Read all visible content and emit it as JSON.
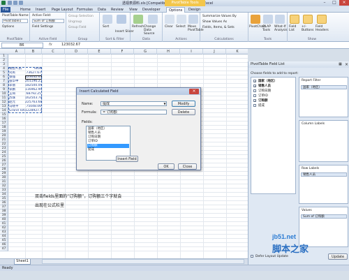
{
  "window": {
    "title": "透视表源料.xls [Compatibility Mode] - Microsoft Excel",
    "context_tab": "PivotTable Tools"
  },
  "tabs": [
    "File",
    "Home",
    "Insert",
    "Page Layout",
    "Formulas",
    "Data",
    "Review",
    "View",
    "Developer",
    "Options",
    "Design"
  ],
  "ribbon": {
    "pivottable": {
      "name_label": "PivotTable Name:",
      "name_value": "PivotTable1",
      "options": "Options",
      "group": "PivotTable"
    },
    "active_field": {
      "label": "Active Field:",
      "value": "Sum of 订购额",
      "settings": "Field Settings",
      "group": "Active Field"
    },
    "group_grp": {
      "items": [
        "Group Selection",
        "Ungroup",
        "Group Field"
      ],
      "group": "Group"
    },
    "sort": {
      "sort": "Sort",
      "group": "Sort & Filter",
      "insert_slicer": "Insert Slicer"
    },
    "data": {
      "refresh": "Refresh",
      "change_source": "Change Data Source",
      "group": "Data"
    },
    "actions": {
      "clear": "Clear",
      "select": "Select",
      "move": "Move PivotTable",
      "group": "Actions"
    },
    "calculations": {
      "items": [
        "Summarize Values By",
        "Show Values As",
        "Fields, Items, & Sets"
      ],
      "group": "Calculations"
    },
    "tools": {
      "items": [
        "PivotChart",
        "OLAP Tools",
        "What-If Analysis"
      ],
      "group": "Tools"
    },
    "show": {
      "items": [
        "Field List",
        "+/- Buttons",
        "Field Headers"
      ],
      "group": "Show"
    }
  },
  "formula_bar": {
    "name_box": "B6",
    "fx": "fx",
    "value": "123032.67"
  },
  "sheet": {
    "columns": [
      "A",
      "B",
      "C",
      "D",
      "E",
      "F",
      "G",
      "H",
      "I",
      "J",
      "K"
    ],
    "rows": [
      {
        "n": "1",
        "a": "",
        "b": ""
      },
      {
        "n": "2",
        "a": "",
        "b": ""
      },
      {
        "n": "3",
        "a": "",
        "b": ""
      },
      {
        "n": "4",
        "a": "销售人员",
        "b": "Total"
      },
      {
        "n": "5",
        "a": "刘英",
        "b": "73627.67"
      },
      {
        "n": "6",
        "a": "张强",
        "b": "123032.67"
      },
      {
        "n": "7",
        "a": "张华中",
        "b": "201196.27"
      },
      {
        "n": "8",
        "a": "李丽",
        "b": "182500.09"
      },
      {
        "n": "9",
        "a": "李鹏",
        "b": "116962.99"
      },
      {
        "n": "10",
        "a": "王琦",
        "b": "68792.25"
      },
      {
        "n": "11",
        "a": "苏珠",
        "b": "162503.78"
      },
      {
        "n": "12",
        "a": "赵元",
        "b": "225763.68"
      },
      {
        "n": "13",
        "a": "马晓平",
        "b": "75048.06"
      },
      {
        "n": "14",
        "a": "Grand Total",
        "b": "1228927.4"
      }
    ],
    "row_numbers": [
      "15",
      "16",
      "17",
      "18",
      "19",
      "20",
      "21",
      "22",
      "23",
      "24",
      "25",
      "26",
      "27",
      "28",
      "29",
      "30",
      "31",
      "32",
      "33",
      "34",
      "35",
      "36",
      "37",
      "38",
      "39",
      "40",
      "41",
      "42",
      "43",
      "44",
      "45",
      "46",
      "47"
    ],
    "tab": "Sheet1",
    "status": "Ready"
  },
  "dialog": {
    "title": "Insert Calculated Field",
    "name_label": "Name:",
    "name_value": "提成",
    "formula_label": "Formula:",
    "formula_value": "= 订购额",
    "modify": "Modify",
    "delete": "Delete",
    "fields_label": "Fields:",
    "fields": [
      "国家（地区）",
      "销售人员",
      "订购日期",
      "订单ID",
      "订购额",
      "提成"
    ],
    "selected_field": "订购额",
    "insert_field": "Insert Field",
    "ok": "OK",
    "close": "Close"
  },
  "annotation": {
    "line1": "双击fields里面的“订购额”，订购额三个字就会",
    "line2": "出现在公式栏里"
  },
  "field_list": {
    "title": "PivotTable Field List",
    "choose": "Choose fields to add to report:",
    "fields": [
      {
        "label": "国家（地区）",
        "checked": true
      },
      {
        "label": "销售人员",
        "checked": true
      },
      {
        "label": "订购日期",
        "checked": false
      },
      {
        "label": "订单ID",
        "checked": false
      },
      {
        "label": "订购额",
        "checked": true
      },
      {
        "label": "提成",
        "checked": false
      }
    ],
    "drag_label": "Drag fields between areas below:",
    "report_filter": "Report Filter",
    "report_filter_item": "国家（地区）",
    "column_labels": "Column Labels",
    "row_labels": "Row Labels",
    "row_labels_item": "销售人员",
    "values": "Values",
    "values_item": "Sum of 订购额",
    "defer": "Defer Layout Update",
    "update": "Update"
  },
  "watermark": {
    "line1": "jb51.net",
    "line2": "脚本之家"
  }
}
